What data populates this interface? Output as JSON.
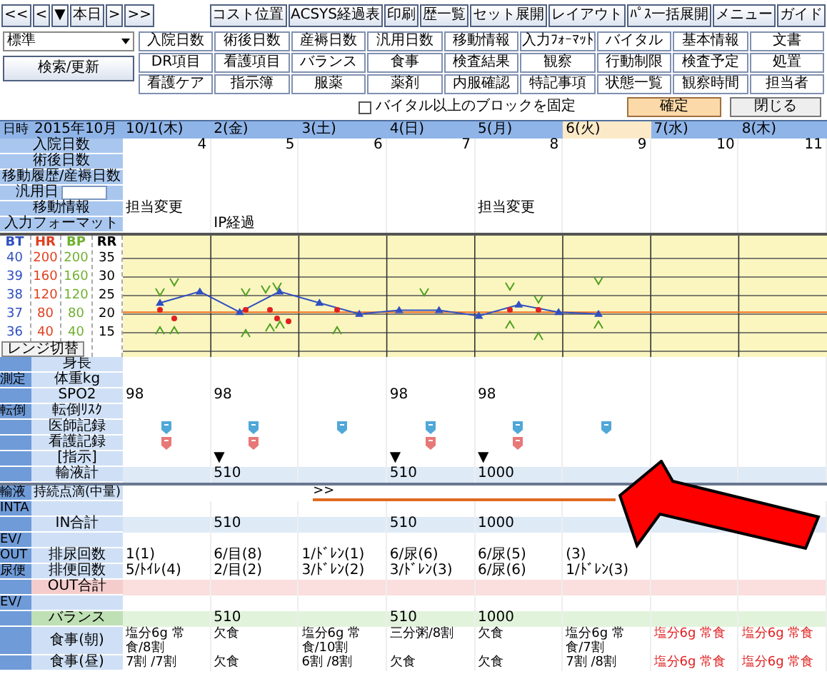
{
  "toolbar": {
    "nav_buttons": [
      "<<",
      "<",
      "▼",
      "本日",
      ">",
      ">>"
    ],
    "buttons": [
      "コスト位置",
      "ACSYS経過表",
      "印刷",
      "歴一覧",
      "セット展開",
      "レイアウト",
      "ﾊﾟｽ一括展開",
      "メニュー",
      "ガイド"
    ]
  },
  "view_select": "標準",
  "search_button": "検索/更新",
  "block_buttons": [
    "入院日数",
    "術後日数",
    "産褥日数",
    "汎用日数",
    "移動情報",
    "入力ﾌｫｰﾏｯﾄ",
    "バイタル",
    "基本情報",
    "文書",
    "DR項目",
    "看護項目",
    "バランス",
    "食事",
    "検査結果",
    "観察",
    "行動制限",
    "検査予定",
    "処置",
    "看護ケア",
    "指示簿",
    "服薬",
    "薬剤",
    "内服確認",
    "特記事項",
    "状態一覧",
    "観察時間",
    "担当者"
  ],
  "fix_block": {
    "label": "バイタル以上のブロックを固定",
    "checked": false
  },
  "confirm_button": "確定",
  "close_button": "閉じる",
  "header": {
    "label": "日時",
    "month": "2015年10月",
    "days": [
      {
        "label": "10/1(木)",
        "selected": false
      },
      {
        "label": "2(金)",
        "selected": false
      },
      {
        "label": "3(土)",
        "selected": false
      },
      {
        "label": "4(日)",
        "selected": false
      },
      {
        "label": "5(月)",
        "selected": false
      },
      {
        "label": "6(火)",
        "selected": true
      },
      {
        "label": "7(水)",
        "selected": false
      },
      {
        "label": "8(木)",
        "selected": false
      }
    ]
  },
  "info_rows": [
    {
      "label": "入院日数",
      "kind": "text",
      "cells": [
        "4",
        "5",
        "6",
        "7",
        "8",
        "9",
        "10",
        "11"
      ]
    },
    {
      "label": "術後日数",
      "kind": "text"
    },
    {
      "label": "移動履歴/産褥日数",
      "kind": "text"
    },
    {
      "label": "汎用日",
      "kind": "input"
    },
    {
      "label": "移動情報",
      "kind": "text",
      "cells": [
        "担当変更",
        null,
        null,
        null,
        "担当変更",
        null,
        null,
        null
      ]
    },
    {
      "label": "入力フォーマット",
      "kind": "text",
      "cells": [
        null,
        "IP経過",
        null,
        null,
        null,
        null,
        null,
        null
      ]
    }
  ],
  "vitals": {
    "axes": [
      {
        "name": "HR",
        "color": "#e04020",
        "ticks": [
          "200",
          "160",
          "120",
          "80",
          "40"
        ]
      },
      {
        "name": "BP",
        "color": "#70b030",
        "ticks": [
          "200",
          "160",
          "120",
          "80",
          "40"
        ]
      },
      {
        "name": "RR",
        "color": "#000000",
        "ticks": [
          "35",
          "30",
          "25",
          "20",
          "15"
        ]
      }
    ],
    "range_button": "レンジ切替",
    "chart_data": {
      "type": "line",
      "categories": [
        null,
        null,
        null,
        null,
        null,
        null,
        null,
        null,
        null,
        null,
        null,
        null
      ],
      "ylim": [
        34.7,
        41.2
      ],
      "yticks": [
        36,
        37,
        38,
        39,
        40
      ],
      "grid": true,
      "ref_lines": [
        {
          "axis": "y",
          "value": 37.1,
          "color": "#f07020"
        }
      ],
      "series": [
        {
          "name": "BT",
          "color": "#3050c0",
          "marker": "triangle",
          "values": [
            37.6,
            38.2,
            37.1,
            38.2,
            37.6,
            37.0,
            37.2,
            37.2,
            36.9,
            37.5,
            37.1,
            37.0
          ]
        }
      ]
    }
  },
  "detail_rows": [
    {
      "label": "身長",
      "kind": "text"
    },
    {
      "sub": "測定",
      "label": "体重kg",
      "kind": "text"
    },
    {
      "label": "SPO2",
      "kind": "text",
      "cells": [
        "98",
        "98",
        null,
        "98",
        "98",
        null,
        null,
        null
      ]
    },
    {
      "sub": "転倒",
      "label": "転倒ﾘｽｸ",
      "kind": "text"
    },
    {
      "label": "医師記録",
      "kind": "doctor_note",
      "cells": [
        true,
        true,
        true,
        true,
        true,
        true,
        false,
        false
      ]
    },
    {
      "label": "看護記録",
      "kind": "nurse_note",
      "cells": [
        true,
        true,
        false,
        true,
        true,
        false,
        false,
        false
      ]
    },
    {
      "label": "[指示]",
      "kind": "text",
      "cells": [
        null,
        "▼",
        null,
        "▼",
        "▼",
        null,
        null,
        null
      ]
    },
    {
      "label": "輸液計",
      "kind": "total",
      "cells": [
        null,
        "510",
        null,
        "510",
        "1000",
        null,
        null,
        null
      ]
    },
    {
      "sub": "輸液",
      "label": "持続点滴(中量)",
      "kind": "infusion",
      "marker": ">>"
    },
    {
      "sub": "INTA",
      "kind": "text"
    },
    {
      "label": "IN合計",
      "kind": "total",
      "cells": [
        null,
        "510",
        null,
        "510",
        "1000",
        null,
        null,
        null
      ]
    },
    {
      "sub": "EV/",
      "kind": "text"
    },
    {
      "sub": "OUT",
      "label": "排尿回数",
      "kind": "text",
      "cells": [
        "1(1)",
        "6/目(8)",
        "1/ﾄﾞﾚﾝ(1)",
        "6/尿(6)",
        "6/尿(5)",
        "(3)",
        null,
        null
      ]
    },
    {
      "sub": "尿便",
      "label": "排便回数",
      "kind": "text",
      "cells": [
        "5/ﾄｲﾚ(4)",
        "2/目(2)",
        "3/ﾄﾞﾚﾝ(2)",
        "3/ﾄﾞﾚﾝ(3)",
        "6/尿(6)",
        "1/ﾄﾞﾚﾝ(3)",
        null,
        null
      ]
    },
    {
      "label": "OUT合計",
      "kind": "out_total"
    },
    {
      "sub": "EV/",
      "kind": "text"
    },
    {
      "label": "バランス",
      "kind": "balance",
      "cells": [
        null,
        "510",
        null,
        "510",
        "1000",
        null,
        null,
        null
      ]
    },
    {
      "label": "食事(朝)",
      "kind": "meal",
      "cells": [
        {
          "text": "塩分6g 常食/8割",
          "planned": false
        },
        {
          "text": "欠食",
          "planned": false
        },
        {
          "text": "塩分6g 常食/10割",
          "planned": false
        },
        {
          "text": "三分粥/8割",
          "planned": false
        },
        {
          "text": "欠食",
          "planned": false
        },
        {
          "text": "塩分6g 常食/7割",
          "planned": false
        },
        {
          "text": "塩分6g 常食",
          "planned": true
        },
        {
          "text": "塩分6g 常食",
          "planned": true
        }
      ]
    },
    {
      "label": "食事(昼)",
      "kind": "meal",
      "cells": [
        {
          "text": "7割 /7割",
          "planned": false
        },
        {
          "text": "欠食",
          "planned": false
        },
        {
          "text": "6割 /8割",
          "planned": false
        },
        {
          "text": "欠食",
          "planned": false
        },
        {
          "text": "欠食",
          "planned": false
        },
        {
          "text": "7割 /8割",
          "planned": false
        },
        {
          "text": "塩分6g 常食",
          "planned": true
        },
        {
          "text": "塩分6g 常食",
          "planned": true
        }
      ]
    }
  ]
}
